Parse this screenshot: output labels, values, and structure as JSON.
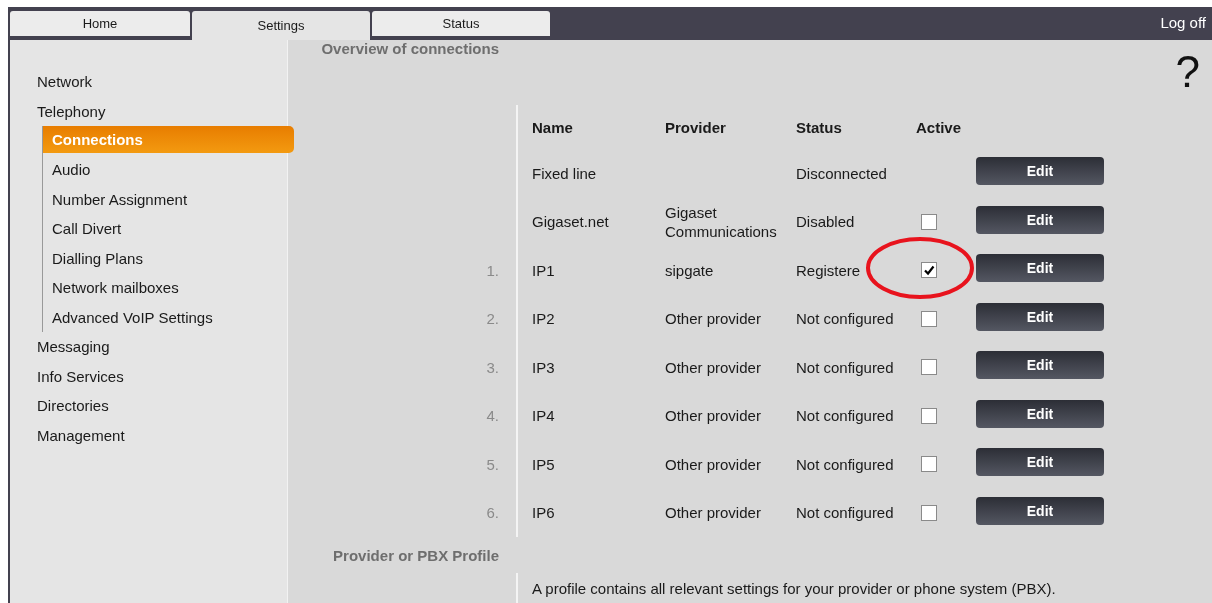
{
  "tabs": [
    {
      "label": "Home",
      "selected": false
    },
    {
      "label": "Settings",
      "selected": true
    },
    {
      "label": "Status",
      "selected": false
    }
  ],
  "logoff": "Log off",
  "help": "?",
  "sidebar": {
    "items": [
      {
        "label": "Network",
        "selected": false
      },
      {
        "label": "Telephony",
        "selected": false,
        "children": [
          {
            "label": "Connections",
            "selected": true
          },
          {
            "label": "Audio",
            "selected": false
          },
          {
            "label": "Number Assignment",
            "selected": false
          },
          {
            "label": "Call Divert",
            "selected": false
          },
          {
            "label": "Dialling Plans",
            "selected": false
          },
          {
            "label": "Network mailboxes",
            "selected": false
          },
          {
            "label": "Advanced VoIP Settings",
            "selected": false
          }
        ]
      },
      {
        "label": "Messaging",
        "selected": false
      },
      {
        "label": "Info Services",
        "selected": false
      },
      {
        "label": "Directories",
        "selected": false
      },
      {
        "label": "Management",
        "selected": false
      }
    ]
  },
  "overview": {
    "title": "Overview of connections",
    "columns": [
      "Name",
      "Provider",
      "Status",
      "Active"
    ],
    "rows": [
      {
        "name": "Fixed line",
        "status": "Disconnected",
        "button": "Edit"
      },
      {
        "name": "Gigaset.net",
        "provider": "Gigaset Communications",
        "status": "Disabled",
        "active": false,
        "button": "Edit"
      },
      {
        "index": "1.",
        "name": "IP1",
        "provider": "sipgate",
        "status": "Registere",
        "active": true,
        "circled": true,
        "button": "Edit"
      },
      {
        "index": "2.",
        "name": "IP2",
        "provider": "Other provider",
        "status": "Not configured",
        "active": false,
        "button": "Edit"
      },
      {
        "index": "3.",
        "name": "IP3",
        "provider": "Other provider",
        "status": "Not configured",
        "active": false,
        "button": "Edit"
      },
      {
        "index": "4.",
        "name": "IP4",
        "provider": "Other provider",
        "status": "Not configured",
        "active": false,
        "button": "Edit"
      },
      {
        "index": "5.",
        "name": "IP5",
        "provider": "Other provider",
        "status": "Not configured",
        "active": false,
        "button": "Edit"
      },
      {
        "index": "6.",
        "name": "IP6",
        "provider": "Other provider",
        "status": "Not configured",
        "active": false,
        "button": "Edit"
      }
    ]
  },
  "profile": {
    "title": "Provider or PBX Profile",
    "text": "A profile contains all relevant settings for your provider or phone system (PBX)."
  }
}
